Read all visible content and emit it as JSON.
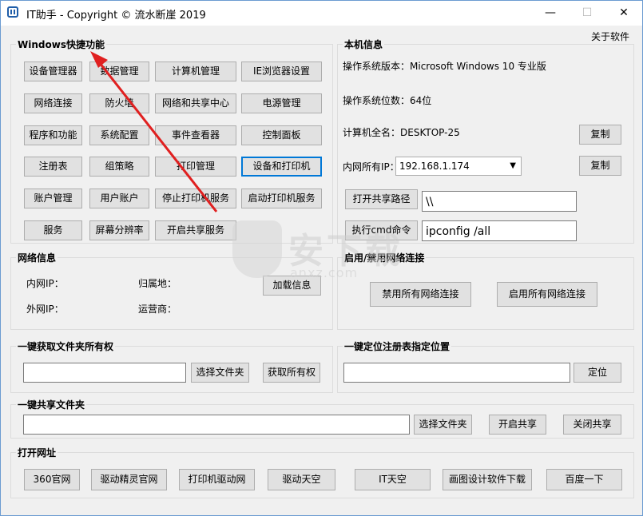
{
  "window": {
    "title": "IT助手 - Copyright © 流水断崖 2019",
    "minimize": "—",
    "maximize": "☐",
    "close": "✕",
    "about": "关于软件"
  },
  "shortcuts": {
    "legend": "Windows快捷功能",
    "buttons": [
      "设备管理器",
      "数据管理",
      "计算机管理",
      "IE浏览器设置",
      "网络连接",
      "防火墙",
      "网络和共享中心",
      "电源管理",
      "程序和功能",
      "系统配置",
      "事件查看器",
      "控制面板",
      "注册表",
      "组策略",
      "打印管理",
      "设备和打印机",
      "账户管理",
      "用户账户",
      "停止打印机服务",
      "启动打印机服务",
      "服务",
      "屏幕分辨率",
      "开启共享服务"
    ]
  },
  "local": {
    "legend": "本机信息",
    "os_version": "操作系统版本：Microsoft Windows 10 专业版",
    "os_bits": "操作系统位数：64位",
    "computer_name": "计算机全名：DESKTOP-25",
    "copy1": "复制",
    "ip_label": "内网所有IP：",
    "ip_value": "192.168.1.174",
    "copy2": "复制",
    "open_share_path": "打开共享路径",
    "share_path_value": "\\\\",
    "run_cmd": "执行cmd命令",
    "cmd_value": "ipconfig /all"
  },
  "network": {
    "legend": "网络信息",
    "lan_ip": "内网IP：",
    "location": "归属地：",
    "wan_ip": "外网IP：",
    "isp": "运营商：",
    "load_info": "加载信息"
  },
  "netconn": {
    "legend": "启用/禁用网络连接",
    "disable_all": "禁用所有网络连接",
    "enable_all": "启用所有网络连接"
  },
  "ownership": {
    "legend": "一键获取文件夹所有权",
    "value": "",
    "choose": "选择文件夹",
    "take": "获取所有权"
  },
  "registry": {
    "legend": "一键定位注册表指定位置",
    "value": "",
    "locate": "定位"
  },
  "share": {
    "legend": "一键共享文件夹",
    "value": "",
    "choose": "选择文件夹",
    "open": "开启共享",
    "close": "关闭共享"
  },
  "urls": {
    "legend": "打开网址",
    "buttons": [
      "360官网",
      "驱动精灵官网",
      "打印机驱动网",
      "驱动天空",
      "IT天空",
      "画图设计软件下载",
      "百度一下"
    ]
  },
  "watermark": {
    "text": "安下载",
    "sub": "anxz.com"
  },
  "colors": {
    "accent": "#0078d7",
    "arrow": "#e02020",
    "button_bg": "#e1e1e1"
  }
}
